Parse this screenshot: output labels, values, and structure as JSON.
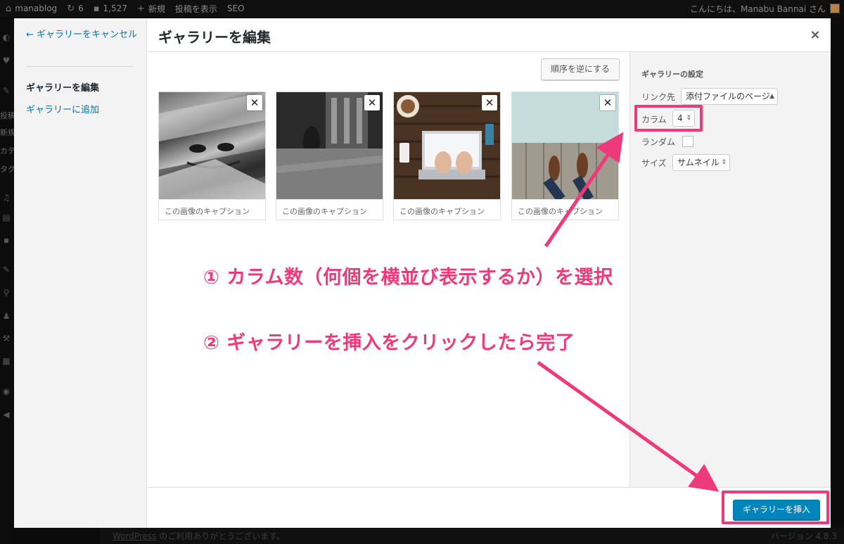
{
  "admin_bar": {
    "site_name": "manablog",
    "updates": "6",
    "comments": "1,527",
    "new": "新規",
    "view_post": "投稿を表示",
    "seo": "SEO",
    "greeting": "こんにちは、Manabu Bannai さん"
  },
  "admin_menu": {
    "posts_cut": "投稿",
    "new_cut": "新規",
    "cat_cut": "カテ",
    "tag_cut": "タグ"
  },
  "modal": {
    "title": "ギャラリーを編集",
    "close_icon": "×",
    "menu": {
      "cancel": "← ギャラリーをキャンセル",
      "edit": "ギャラリーを編集",
      "add": "ギャラリーに追加"
    },
    "reverse_button": "順序を逆にする",
    "attachments": [
      {
        "caption": "この画像のキャプション",
        "remove": "✕"
      },
      {
        "caption": "この画像のキャプション",
        "remove": "✕"
      },
      {
        "caption": "この画像のキャプション",
        "remove": "✕"
      },
      {
        "caption": "この画像のキャプション",
        "remove": "✕"
      }
    ],
    "settings": {
      "heading": "ギャラリーの設定",
      "link_label": "リンク先",
      "link_value": "添付ファイルのページ",
      "columns_label": "カラム",
      "columns_value": "4",
      "random_label": "ランダム",
      "random_checked": false,
      "size_label": "サイズ",
      "size_value": "サムネイル"
    },
    "insert_button": "ギャラリーを挿入"
  },
  "annotations": {
    "step1": "① カラム数（何個を横並び表示するか）を選択",
    "step2": "② ギャラリーを挿入をクリックしたら完了",
    "color": "#ee3a7a"
  },
  "footer": {
    "thanks_link": "WordPress",
    "thanks_rest": " のご利用ありがとうございます。",
    "version": "バージョン 4.8.3"
  },
  "colors": {
    "primary_button": "#0085ba",
    "link": "#0073aa",
    "annotation": "#ee3a7a"
  }
}
